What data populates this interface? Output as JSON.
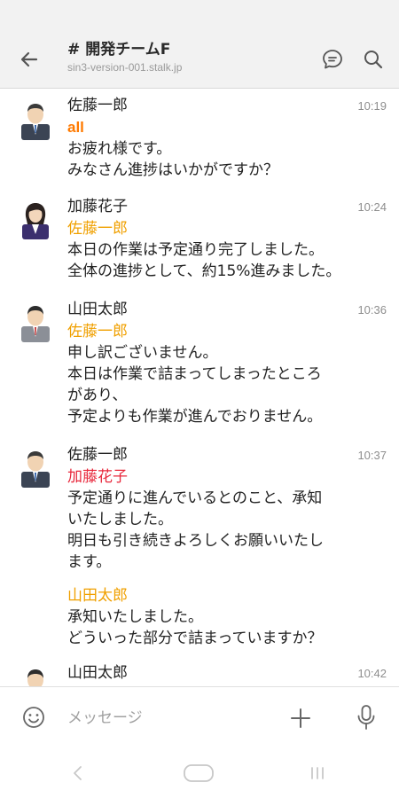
{
  "header": {
    "channel_hash": "#",
    "channel_name": "開発チームF",
    "domain": "sin3-version-001.stalk.jp"
  },
  "messages": [
    {
      "sender": "佐藤一郎",
      "time": "10:19",
      "avatar": "male-suit-avatar",
      "mention": "all",
      "mention_color": "#ff7a00",
      "lines": [
        "お疲れ様です。",
        "みなさん進捗はいかがですか？"
      ]
    },
    {
      "sender": "加藤花子",
      "time": "10:24",
      "avatar": "female-avatar",
      "mention": "佐藤一郎",
      "mention_color": "#f0a000",
      "lines": [
        "本日の作業は予定通り完了しました。",
        "全体の進捗として、約15%進みました。"
      ]
    },
    {
      "sender": "山田太郎",
      "time": "10:36",
      "avatar": "male-gray-avatar",
      "mention": "佐藤一郎",
      "mention_color": "#f0a000",
      "lines": [
        "申し訳ございません。",
        "本日は作業で詰まってしまったところ",
        "があり、",
        "予定よりも作業が進んでおりません。"
      ]
    },
    {
      "sender": "佐藤一郎",
      "time": "10:37",
      "avatar": "male-suit-avatar",
      "mention": "加藤花子",
      "mention_color": "#e8283c",
      "lines": [
        "予定通りに進んでいるとのこと、承知",
        "いたしました。",
        "明日も引き続きよろしくお願いいたし",
        "ます。"
      ],
      "mention2": "山田太郎",
      "mention2_color": "#f0a000",
      "lines2": [
        "承知いたしました。",
        "どういった部分で詰まっていますか？"
      ]
    },
    {
      "sender": "山田太郎",
      "time": "10:42",
      "avatar": "male-gray-avatar"
    }
  ],
  "composer": {
    "placeholder": "メッセージ",
    "icons": [
      "emoji-icon",
      "plus-icon",
      "mic-icon"
    ]
  },
  "colors": {
    "header_bg": "#f2f2f2",
    "mention_orange": "#f0a000",
    "mention_red": "#e8283c",
    "mention_all": "#ff7a00"
  }
}
